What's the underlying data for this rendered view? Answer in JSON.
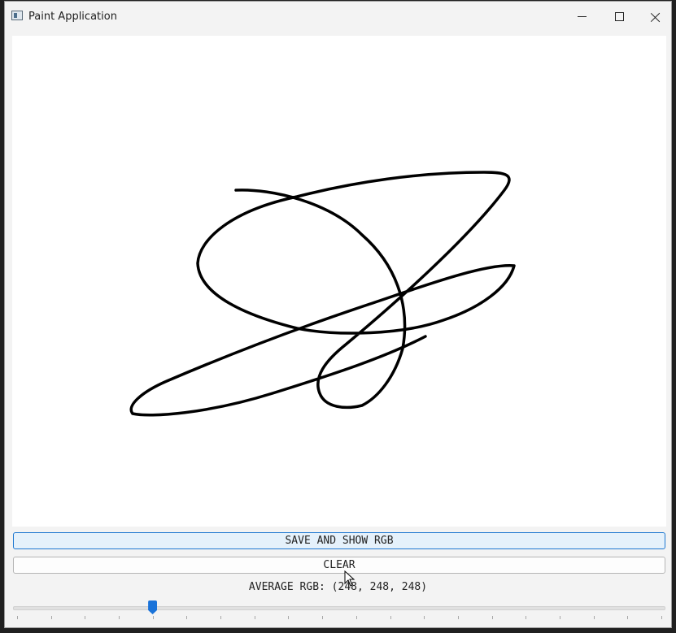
{
  "window": {
    "title": "Paint Application",
    "controls": [
      "minimize",
      "maximize",
      "close"
    ]
  },
  "canvas": {
    "background": "#ffffff",
    "stroke_color": "#000000"
  },
  "buttons": {
    "save_label": "SAVE AND SHOW RGB",
    "clear_label": "CLEAR"
  },
  "status": {
    "average_rgb_text": "AVERAGE RGB: (248, 248, 248)"
  },
  "slider": {
    "value_fraction": 0.21,
    "tick_count": 20,
    "accent": "#1a73d9"
  },
  "colors": {
    "accent": "#1f78d1",
    "title_bar": "#f3f3f3"
  }
}
